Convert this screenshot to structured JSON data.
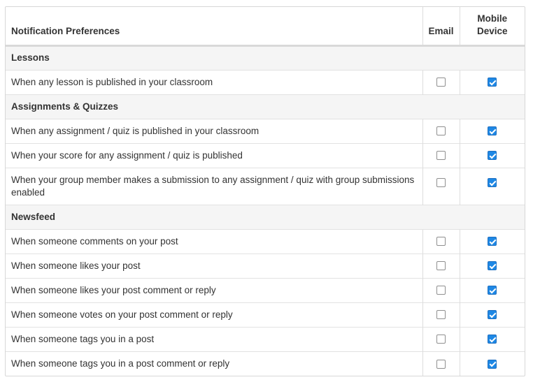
{
  "header": {
    "title": "Notification Preferences",
    "email": "Email",
    "mobile": "Mobile Device"
  },
  "sections": [
    {
      "title": "Lessons",
      "rows": [
        {
          "label": "When any lesson is published in your classroom",
          "email": false,
          "mobile": true
        }
      ]
    },
    {
      "title": "Assignments & Quizzes",
      "rows": [
        {
          "label": "When any assignment / quiz is published in your classroom",
          "email": false,
          "mobile": true
        },
        {
          "label": "When your score for any assignment / quiz is published",
          "email": false,
          "mobile": true
        },
        {
          "label": "When your group member makes a submission to any assignment / quiz with group submissions enabled",
          "email": false,
          "mobile": true
        }
      ]
    },
    {
      "title": "Newsfeed",
      "rows": [
        {
          "label": "When someone comments on your post",
          "email": false,
          "mobile": true
        },
        {
          "label": "When someone likes your post",
          "email": false,
          "mobile": true
        },
        {
          "label": "When someone likes your post comment or reply",
          "email": false,
          "mobile": true
        },
        {
          "label": "When someone votes on your post comment or reply",
          "email": false,
          "mobile": true
        },
        {
          "label": "When someone tags you in a post",
          "email": false,
          "mobile": true
        },
        {
          "label": "When someone tags you in a post comment or reply",
          "email": false,
          "mobile": true
        }
      ]
    }
  ]
}
